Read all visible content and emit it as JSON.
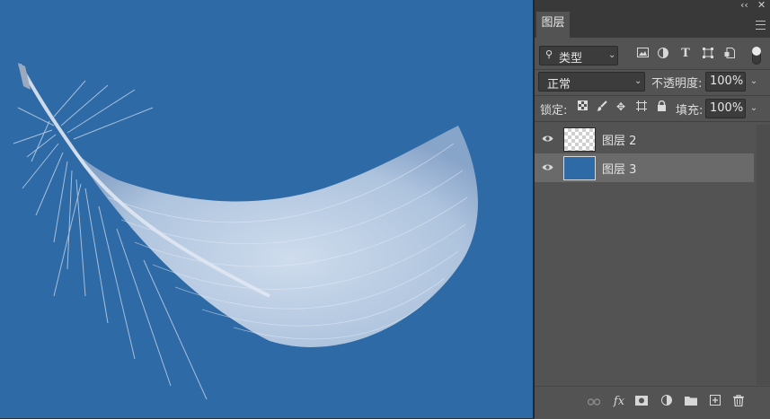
{
  "panel": {
    "collapse_glyph": "‹‹",
    "close_glyph": "✕",
    "tab_label": "图层"
  },
  "filter": {
    "label": "类型",
    "icons": [
      "image-filter-icon",
      "adjustment-filter-icon",
      "type-filter-icon",
      "shape-filter-icon",
      "smart-object-filter-icon"
    ]
  },
  "blend": {
    "mode": "正常",
    "opacity_label": "不透明度:",
    "opacity_value": "100%"
  },
  "lock": {
    "label": "锁定:",
    "icons": [
      "lock-transparency-icon",
      "lock-pixels-icon",
      "lock-position-icon",
      "lock-artboard-icon",
      "lock-all-icon"
    ],
    "fill_label": "填充:",
    "fill_value": "100%"
  },
  "layers": [
    {
      "name": "图层 2",
      "visible": true,
      "selected": false,
      "thumb": "transparent-feather"
    },
    {
      "name": "图层 3",
      "visible": true,
      "selected": true,
      "thumb": "solid-blue"
    }
  ],
  "bottom_icons": [
    "link-layers-icon",
    "fx-icon",
    "add-mask-icon",
    "adjustment-layer-icon",
    "group-folder-icon",
    "new-layer-icon",
    "trash-icon"
  ],
  "colors": {
    "canvas_background": "#2e6aa5",
    "panel_background": "#535353",
    "selected_layer": "#6a6a6a",
    "feather": "#c7d6ea"
  }
}
